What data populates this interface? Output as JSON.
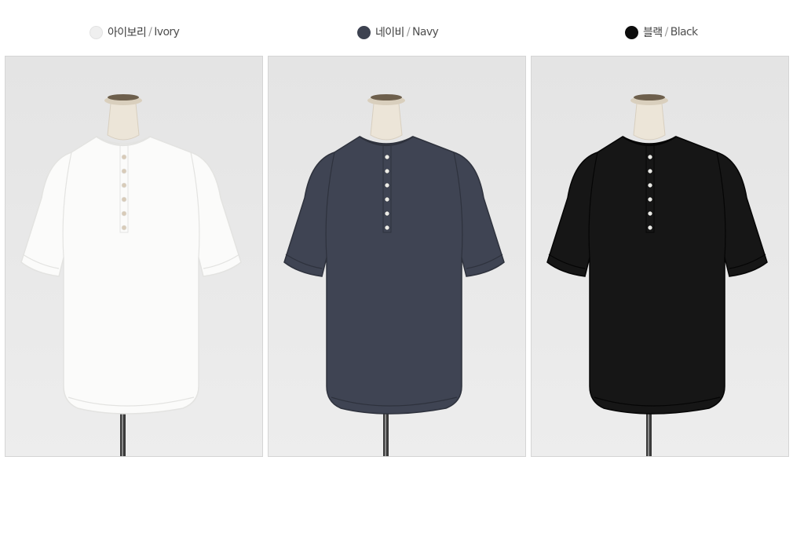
{
  "colors": [
    {
      "ko": "아이보리",
      "separator": "/",
      "en": "Ivory",
      "swatch_color": "#efefef",
      "swatch_border": "#e2e2e2",
      "shirt_color": "#fbfbfa",
      "shirt_shade": "#e3e3e1",
      "button_color": "#d8cbb8",
      "photo_alt": "ivory henley short-sleeve t-shirt on mannequin"
    },
    {
      "ko": "네이비",
      "separator": "/",
      "en": "Navy",
      "swatch_color": "#3d4250",
      "swatch_border": "#3d4250",
      "shirt_color": "#3f4453",
      "shirt_shade": "#2e323d",
      "button_color": "#ecebe6",
      "photo_alt": "navy henley short-sleeve t-shirt on mannequin"
    },
    {
      "ko": "블랙",
      "separator": "/",
      "en": "Black",
      "swatch_color": "#0c0c0c",
      "swatch_border": "#0c0c0c",
      "shirt_color": "#161616",
      "shirt_shade": "#050505",
      "button_color": "#e8e8e4",
      "photo_alt": "black henley short-sleeve t-shirt on mannequin"
    }
  ]
}
